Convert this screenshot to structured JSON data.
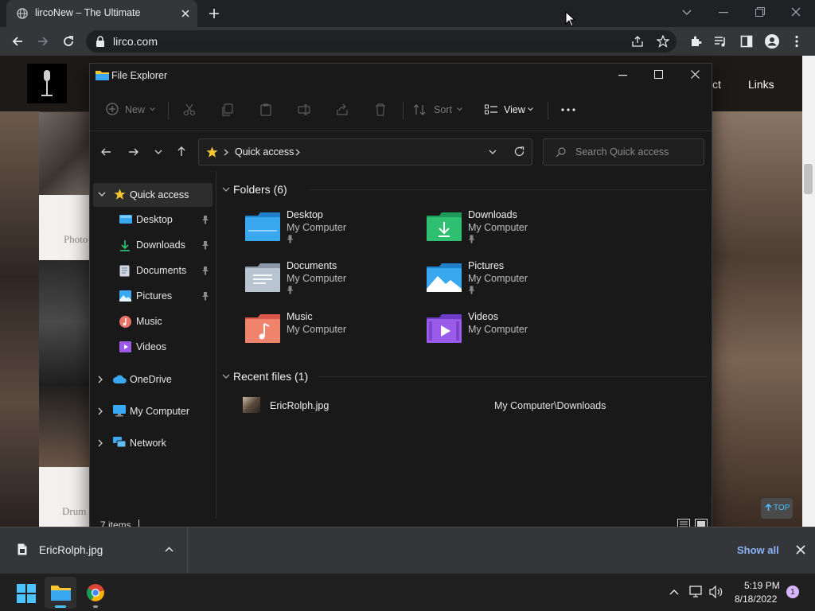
{
  "browser": {
    "tab_title": "lircoNew – The Ultimate",
    "url": "lirco.com",
    "page_nav_link": "Links",
    "page_nav_partial": "ct",
    "page_text_1": "Photo",
    "page_text_2": "Drum",
    "top_button": "TOP"
  },
  "explorer": {
    "title": "File Explorer",
    "toolbar": {
      "new": "New",
      "sort": "Sort",
      "view": "View"
    },
    "breadcrumb": "Quick access",
    "search_placeholder": "Search Quick access",
    "sidebar": {
      "quick_access": "Quick access",
      "items": [
        "Desktop",
        "Downloads",
        "Documents",
        "Pictures",
        "Music",
        "Videos"
      ],
      "onedrive": "OneDrive",
      "my_computer": "My Computer",
      "network": "Network"
    },
    "folders_header": "Folders (6)",
    "folders": [
      {
        "name": "Desktop",
        "location": "My Computer"
      },
      {
        "name": "Downloads",
        "location": "My Computer"
      },
      {
        "name": "Documents",
        "location": "My Computer"
      },
      {
        "name": "Pictures",
        "location": "My Computer"
      },
      {
        "name": "Music",
        "location": "My Computer"
      },
      {
        "name": "Videos",
        "location": "My Computer"
      }
    ],
    "recent_header": "Recent files (1)",
    "recent": [
      {
        "name": "EricRolph.jpg",
        "path": "My Computer\\Downloads"
      }
    ],
    "status": "7 items"
  },
  "download_bar": {
    "file": "EricRolph.jpg",
    "show_all": "Show all"
  },
  "taskbar": {
    "time": "5:19 PM",
    "date": "8/18/2022",
    "notification_count": "1"
  },
  "colors": {
    "accent_blue": "#4cc2ff",
    "star": "#f8c630",
    "folder_blue": "#3aa8f0",
    "folder_green": "#2fbf71"
  }
}
